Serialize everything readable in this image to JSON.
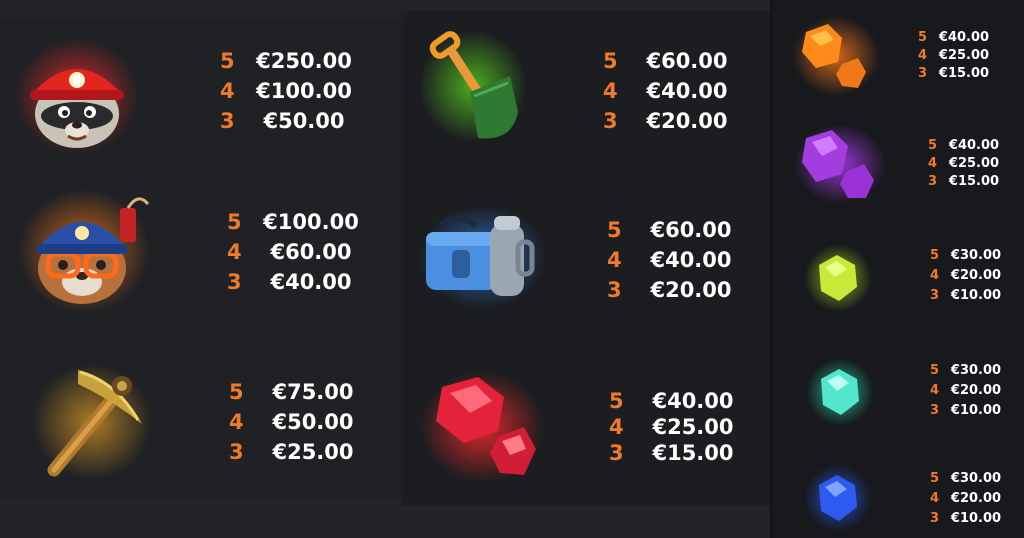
{
  "paytable": {
    "column1": [
      {
        "symbol": "red-helmet-raccoon-icon",
        "payouts": [
          {
            "count": "5",
            "amount": "€250.00"
          },
          {
            "count": "4",
            "amount": "€100.00"
          },
          {
            "count": "3",
            "amount": "€50.00"
          }
        ]
      },
      {
        "symbol": "blue-helmet-miner-icon",
        "payouts": [
          {
            "count": "5",
            "amount": "€100.00"
          },
          {
            "count": "4",
            "amount": "€60.00"
          },
          {
            "count": "3",
            "amount": "€40.00"
          }
        ]
      },
      {
        "symbol": "pickaxe-icon",
        "payouts": [
          {
            "count": "5",
            "amount": "€75.00"
          },
          {
            "count": "4",
            "amount": "€50.00"
          },
          {
            "count": "3",
            "amount": "€25.00"
          }
        ]
      }
    ],
    "column2": [
      {
        "symbol": "shovel-icon",
        "payouts": [
          {
            "count": "5",
            "amount": "€60.00"
          },
          {
            "count": "4",
            "amount": "€40.00"
          },
          {
            "count": "3",
            "amount": "€20.00"
          }
        ]
      },
      {
        "symbol": "lunchbox-thermos-icon",
        "payouts": [
          {
            "count": "5",
            "amount": "€60.00"
          },
          {
            "count": "4",
            "amount": "€40.00"
          },
          {
            "count": "3",
            "amount": "€20.00"
          }
        ]
      },
      {
        "symbol": "red-gems-icon",
        "payouts": [
          {
            "count": "5",
            "amount": "€40.00"
          },
          {
            "count": "4",
            "amount": "€25.00"
          },
          {
            "count": "3",
            "amount": "€15.00"
          }
        ]
      }
    ],
    "column3": [
      {
        "symbol": "orange-gems-icon",
        "payouts": [
          {
            "count": "5",
            "amount": "€40.00"
          },
          {
            "count": "4",
            "amount": "€25.00"
          },
          {
            "count": "3",
            "amount": "€15.00"
          }
        ]
      },
      {
        "symbol": "purple-gems-icon",
        "payouts": [
          {
            "count": "5",
            "amount": "€40.00"
          },
          {
            "count": "4",
            "amount": "€25.00"
          },
          {
            "count": "3",
            "amount": "€15.00"
          }
        ]
      },
      {
        "symbol": "yellow-gem-icon",
        "payouts": [
          {
            "count": "5",
            "amount": "€30.00"
          },
          {
            "count": "4",
            "amount": "€20.00"
          },
          {
            "count": "3",
            "amount": "€10.00"
          }
        ]
      },
      {
        "symbol": "cyan-gem-icon",
        "payouts": [
          {
            "count": "5",
            "amount": "€30.00"
          },
          {
            "count": "4",
            "amount": "€20.00"
          },
          {
            "count": "3",
            "amount": "€10.00"
          }
        ]
      },
      {
        "symbol": "blue-gem-icon",
        "payouts": [
          {
            "count": "5",
            "amount": "€30.00"
          },
          {
            "count": "4",
            "amount": "€20.00"
          },
          {
            "count": "3",
            "amount": "€10.00"
          }
        ]
      }
    ]
  },
  "colors": {
    "background": "#222427",
    "count_color": "#f07a2a",
    "amount_color": "#ffffff"
  }
}
